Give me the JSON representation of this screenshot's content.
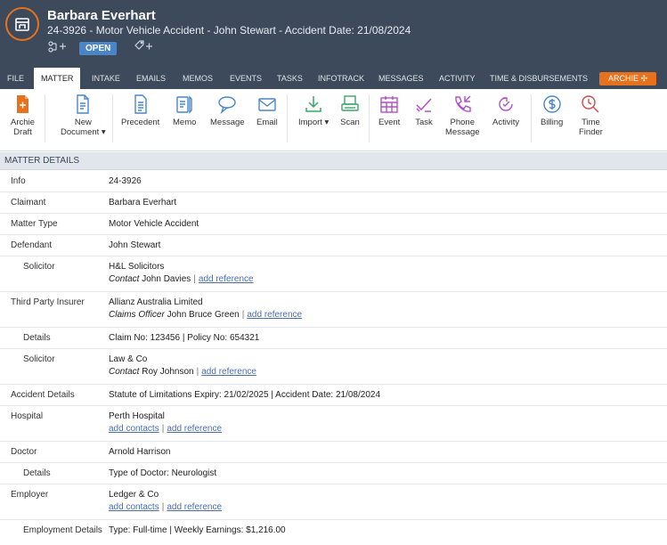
{
  "header": {
    "client_name": "Barbara Everhart",
    "matter_line": "24-3926 - Motor Vehicle Accident - John Stewart - Accident Date: 21/08/2024",
    "status": "OPEN",
    "accent": "#e8711c",
    "bg": "#3d4a5c"
  },
  "tabs": [
    "FILE",
    "MATTER",
    "INTAKE",
    "EMAILS",
    "MEMOS",
    "EVENTS",
    "TASKS",
    "INFOTRACK",
    "MESSAGES",
    "ACTIVITY",
    "TIME & DISBURSEMENTS"
  ],
  "active_tab": "MATTER",
  "archie_button": "ARCHIE ✣",
  "toolbar": {
    "archie_draft": "Archie\nDraft",
    "archie_draft_l1": "Archie",
    "archie_draft_l2": "Draft",
    "new_document_l1": "New",
    "new_document_l2": "Document ▾",
    "precedent": "Precedent",
    "memo": "Memo",
    "message": "Message",
    "email": "Email",
    "import": "Import ▾",
    "scan": "Scan",
    "event": "Event",
    "task": "Task",
    "phone_message_l1": "Phone",
    "phone_message_l2": "Message",
    "activity": "Activity",
    "billing": "Billing",
    "time_finder_l1": "Time",
    "time_finder_l2": "Finder"
  },
  "section_title": "MATTER DETAILS",
  "details": {
    "info": {
      "label": "Info",
      "value": "24-3926"
    },
    "claimant": {
      "label": "Claimant",
      "value": "Barbara Everhart"
    },
    "matter_type": {
      "label": "Matter Type",
      "value": "Motor Vehicle Accident"
    },
    "defendant": {
      "label": "Defendant",
      "value": "John Stewart"
    },
    "def_solicitor": {
      "label": "Solicitor",
      "value": "H&L Solicitors",
      "contact_role": "Contact",
      "contact_name": "John Davies",
      "link": "add reference"
    },
    "third_party": {
      "label": "Third Party Insurer",
      "value": "Allianz Australia Limited",
      "contact_role": "Claims Officer",
      "contact_name": "John Bruce Green",
      "link": "add reference"
    },
    "tp_details": {
      "label": "Details",
      "value": "Claim No: 123456 | Policy No: 654321"
    },
    "tp_solicitor": {
      "label": "Solicitor",
      "value": "Law & Co",
      "contact_role": "Contact",
      "contact_name": "Roy Johnson",
      "link": "add reference"
    },
    "accident": {
      "label": "Accident Details",
      "value": "Statute of Limitations Expiry: 21/02/2025 | Accident Date: 21/08/2024"
    },
    "hospital": {
      "label": "Hospital",
      "value": "Perth Hospital",
      "link1": "add contacts",
      "link2": "add reference"
    },
    "doctor": {
      "label": "Doctor",
      "value": "Arnold Harrison"
    },
    "doctor_details": {
      "label": "Details",
      "value": "Type of Doctor: Neurologist"
    },
    "employer": {
      "label": "Employer",
      "value": "Ledger & Co",
      "link1": "add contacts",
      "link2": "add reference"
    },
    "employment": {
      "label": "Employment Details",
      "value": "Type: Full-time | Weekly Earnings: $1,216.00"
    }
  }
}
